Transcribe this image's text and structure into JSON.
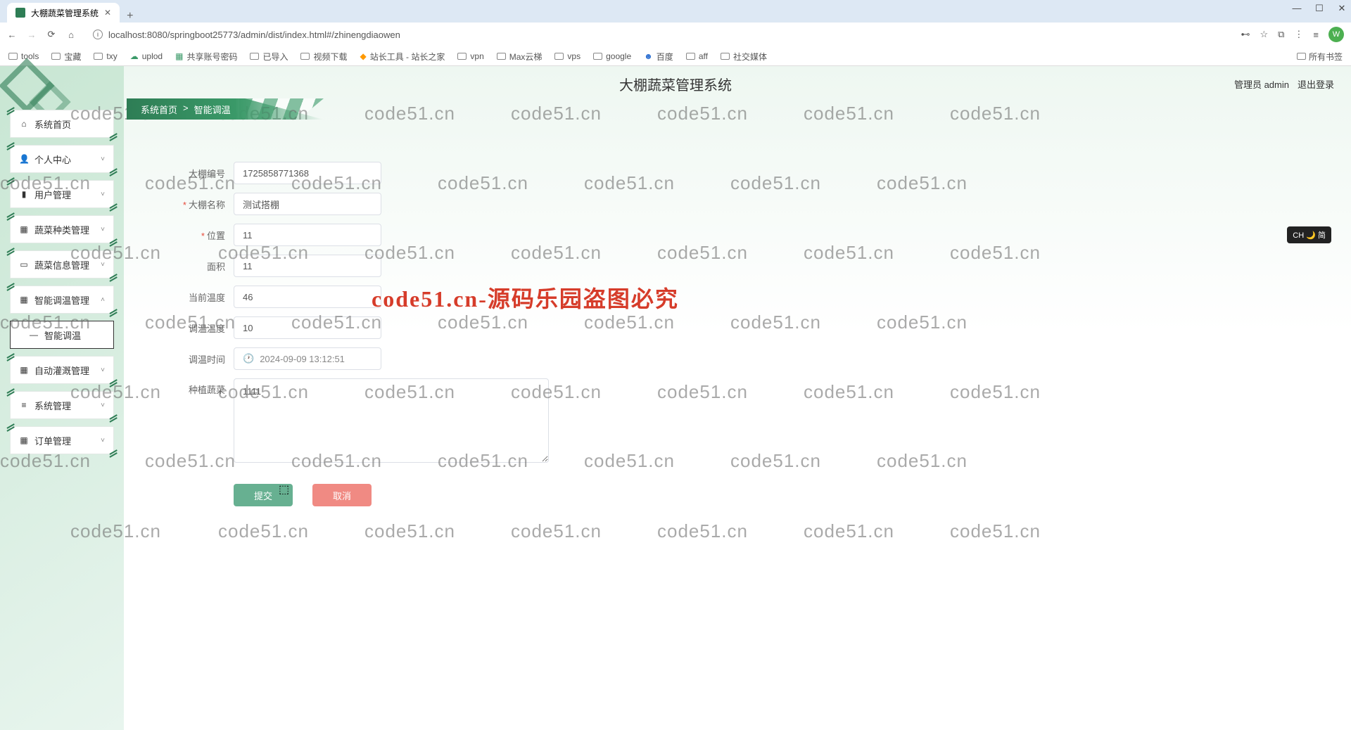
{
  "browser": {
    "tab_title": "大棚蔬菜管理系统",
    "url": "localhost:8080/springboot25773/admin/dist/index.html#/zhinengdiaowen",
    "profile_initial": "W",
    "window_controls": {
      "min": "—",
      "max": "☐",
      "close": "✕"
    },
    "new_tab": "+",
    "tab_close": "✕",
    "nav": {
      "back": "←",
      "forward": "→",
      "reload": "⟳",
      "home": "⌂"
    },
    "right_icons": [
      "⊷",
      "☆",
      "⧉",
      "⋮",
      "≡"
    ],
    "bookmarks": [
      {
        "label": "tools"
      },
      {
        "label": "宝藏"
      },
      {
        "label": "txy"
      },
      {
        "label": "uplod"
      },
      {
        "label": "共享账号密码"
      },
      {
        "label": "已导入"
      },
      {
        "label": "视频下载"
      },
      {
        "label": "站长工具 - 站长之家"
      },
      {
        "label": "vpn"
      },
      {
        "label": "Max云梯"
      },
      {
        "label": "vps"
      },
      {
        "label": "google"
      },
      {
        "label": "百度"
      },
      {
        "label": "aff"
      },
      {
        "label": "社交媒体"
      }
    ],
    "bookmarks_right": "所有书签"
  },
  "app": {
    "title": "大棚蔬菜管理系统",
    "user_role": "管理员 admin",
    "logout": "退出登录"
  },
  "breadcrumb": {
    "home": "系统首页",
    "sep": ">",
    "current": "智能调温"
  },
  "sidebar": [
    {
      "icon": "⌂",
      "label": "系统首页",
      "expandable": false
    },
    {
      "icon": "👤",
      "label": "个人中心",
      "expandable": true,
      "chevron": "˅"
    },
    {
      "icon": "▮",
      "label": "用户管理",
      "expandable": true,
      "chevron": "˅"
    },
    {
      "icon": "▦",
      "label": "蔬菜种类管理",
      "expandable": true,
      "chevron": "˅"
    },
    {
      "icon": "▭",
      "label": "蔬菜信息管理",
      "expandable": true,
      "chevron": "˅"
    },
    {
      "icon": "▦",
      "label": "智能调温管理",
      "expandable": true,
      "chevron": "˄",
      "expanded": true
    },
    {
      "icon": "—",
      "label": "智能调温",
      "sub": true,
      "active": true
    },
    {
      "icon": "▦",
      "label": "自动灌溉管理",
      "expandable": true,
      "chevron": "˅"
    },
    {
      "icon": "≡",
      "label": "系统管理",
      "expandable": true,
      "chevron": "˅"
    },
    {
      "icon": "▦",
      "label": "订单管理",
      "expandable": true,
      "chevron": "˅"
    }
  ],
  "form": {
    "fields": [
      {
        "label": "大棚编号",
        "value": "1725858771368",
        "required": false,
        "type": "text"
      },
      {
        "label": "大棚名称",
        "value": "测试搭棚",
        "required": true,
        "type": "text"
      },
      {
        "label": "位置",
        "value": "11",
        "required": true,
        "type": "text"
      },
      {
        "label": "面积",
        "value": "11",
        "required": false,
        "type": "text"
      },
      {
        "label": "当前温度",
        "value": "46",
        "required": false,
        "type": "text"
      },
      {
        "label": "调温温度",
        "value": "10",
        "required": false,
        "type": "text"
      },
      {
        "label": "调温时间",
        "value": "2024-09-09 13:12:51",
        "required": false,
        "type": "date"
      },
      {
        "label": "种植蔬菜",
        "value": "1111",
        "required": false,
        "type": "textarea"
      }
    ],
    "submit": "提交",
    "cancel": "取消"
  },
  "watermark": {
    "small": "code51.cn",
    "big": "code51.cn-源码乐园盗图必究"
  },
  "ime": "CH 🌙 简"
}
